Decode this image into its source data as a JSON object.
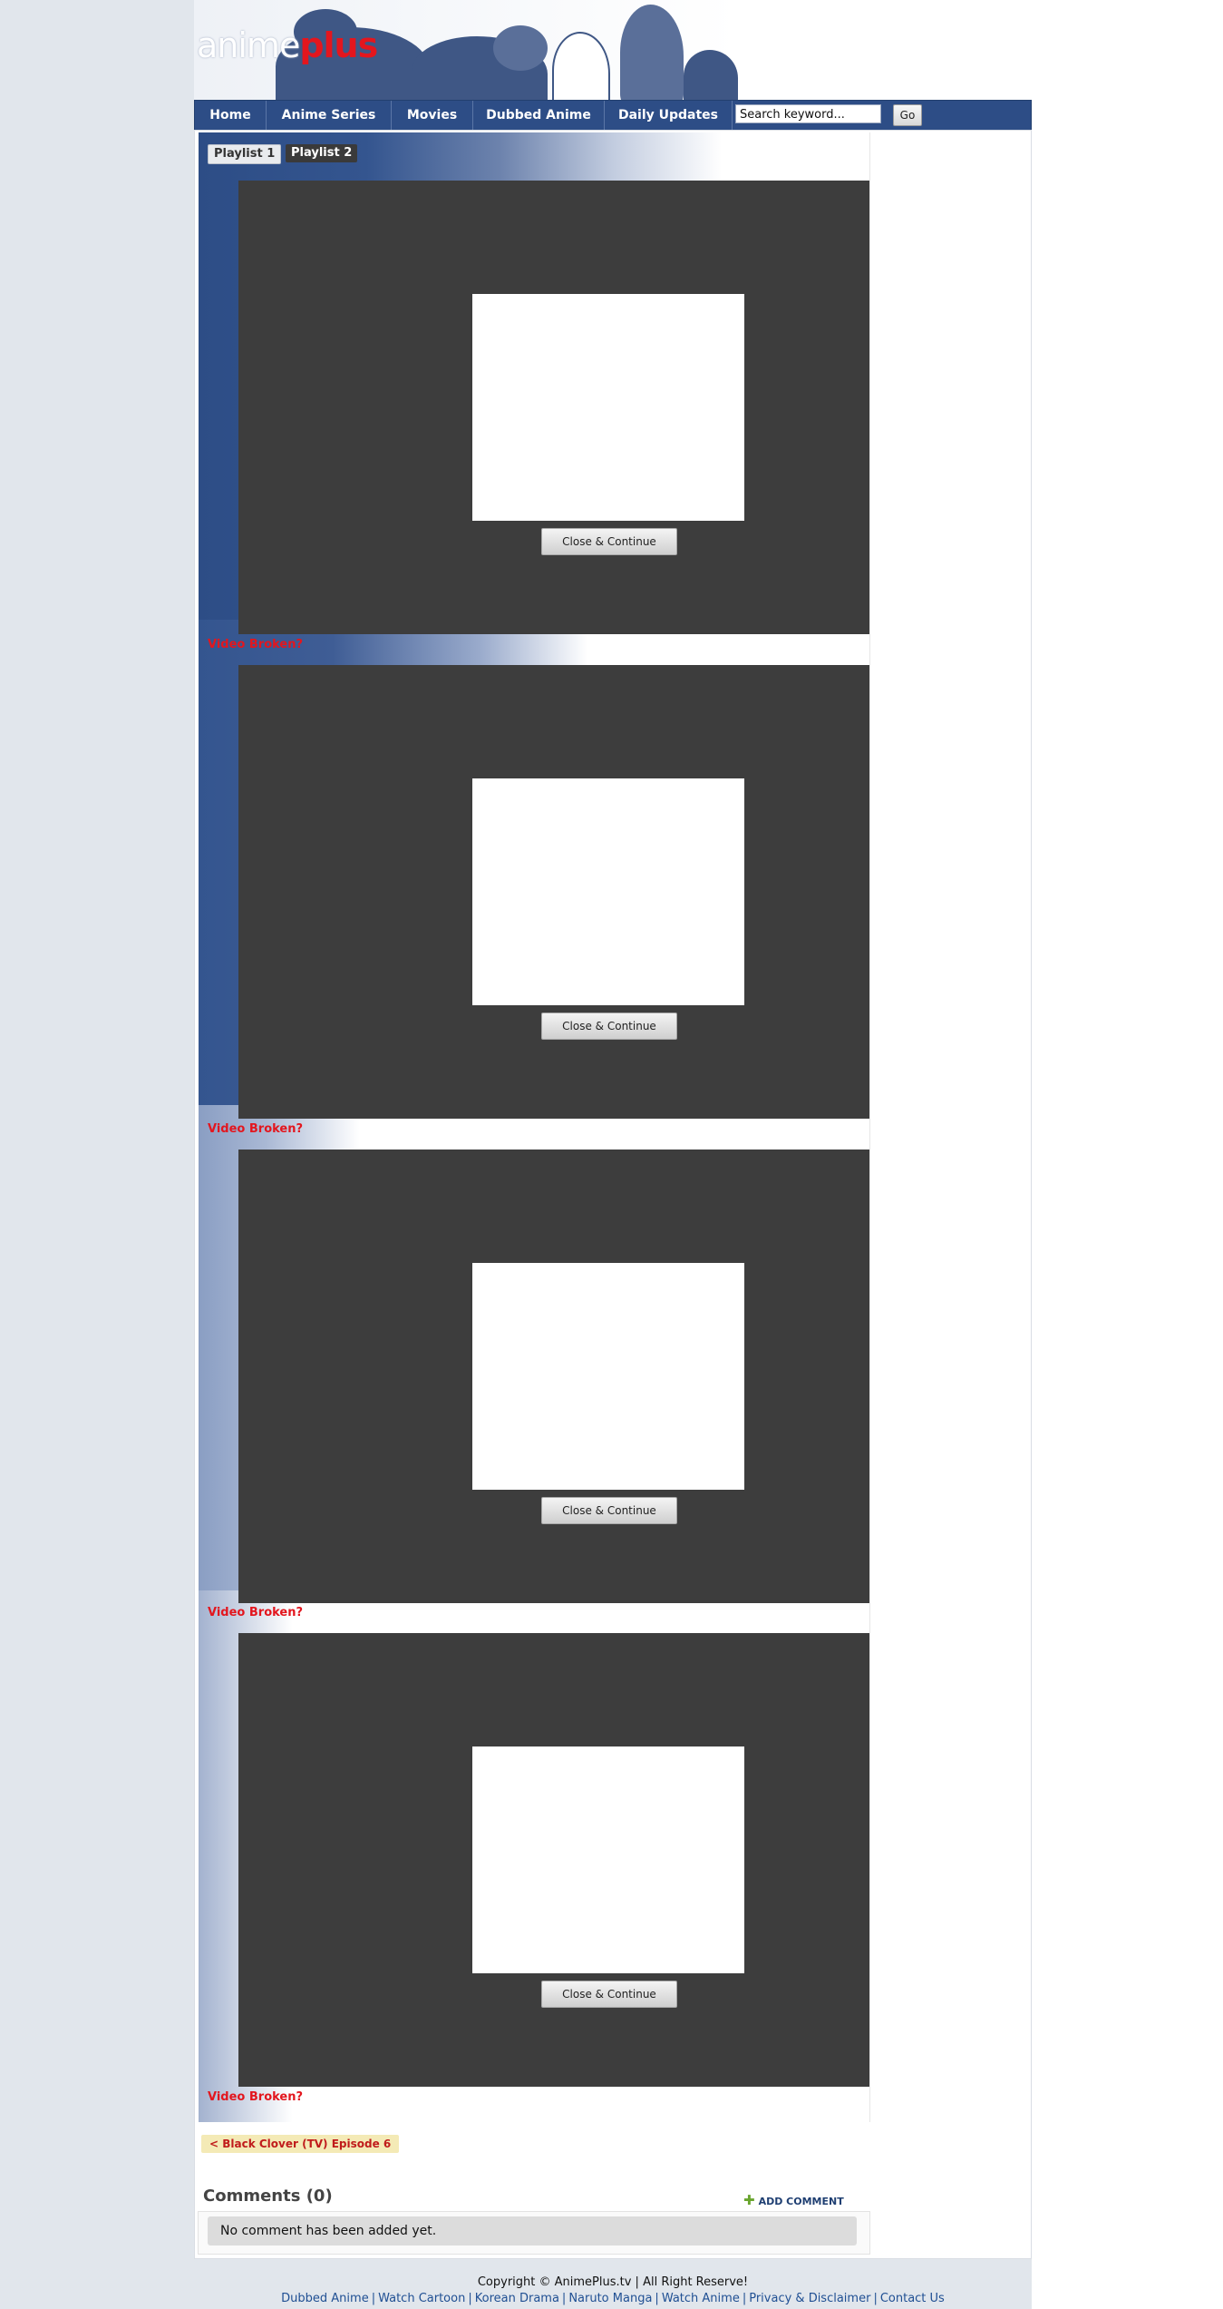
{
  "header": {
    "logo_part1": "anime",
    "logo_part2": "plus"
  },
  "nav": {
    "items": [
      {
        "label": "Home"
      },
      {
        "label": "Anime Series"
      },
      {
        "label": "Movies"
      },
      {
        "label": "Dubbed Anime"
      },
      {
        "label": "Daily Updates"
      }
    ],
    "search_value": "Search keyword...",
    "go_label": "Go"
  },
  "playlist_tabs": [
    {
      "label": "Playlist 1",
      "active": true
    },
    {
      "label": "Playlist 2",
      "active": false
    }
  ],
  "players": [
    {
      "close_label": "Close & Continue",
      "broken_label": "Video Broken?"
    },
    {
      "close_label": "Close & Continue",
      "broken_label": "Video Broken?"
    },
    {
      "close_label": "Close & Continue",
      "broken_label": "Video Broken?"
    },
    {
      "close_label": "Close & Continue",
      "broken_label": "Video Broken?"
    }
  ],
  "prev_episode": "< Black Clover (TV) Episode 6",
  "comments": {
    "title": "Comments (0)",
    "add_label": "ADD COMMENT",
    "empty_message": "No comment has been added yet."
  },
  "footer": {
    "copyright": "Copyright © AnimePlus.tv | All Right Reserve!",
    "links": [
      "Dubbed Anime",
      "Watch Cartoon",
      "Korean Drama",
      "Naruto Manga",
      "Watch Anime",
      "Privacy & Disclaimer",
      "Contact Us"
    ]
  },
  "colors": {
    "nav_blue": "#2d4d86",
    "accent_red": "#e3161e",
    "player_bg": "#3d3d3d",
    "link_blue": "#1f4f93"
  }
}
